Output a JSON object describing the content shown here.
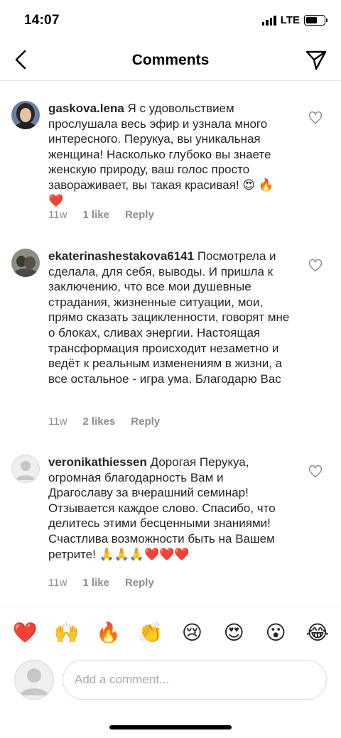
{
  "status_bar": {
    "time": "14:07",
    "network": "LTE",
    "battery_level": 0.62
  },
  "nav": {
    "title": "Comments",
    "back_icon": "chevron-left-icon",
    "send_icon": "paper-plane-icon"
  },
  "comments": [
    {
      "username": "gaskova.lena",
      "text": "Я с удовольствием прослушала весь эфир и узнала много интересного. Перукуа, вы уникальная женщина! Насколько глубоко вы знаете женскую природу, ваш голос просто завораживает, вы такая красивая! 😍 🔥 ❤️",
      "time": "11w",
      "likes": "1 like",
      "reply_label": "Reply"
    },
    {
      "username": "ekaterinashestakova6141",
      "text": "Посмотрела и сделала, для себя, выводы. И пришла к заключению, что все мои душевные страдания, жизненные ситуации, мои, прямо сказать зацикленности, говорят мне о блоках, сливах энергии. Настоящая трансформация происходит незаметно и ведёт к реальным изменениям в жизни, а все остальное - игра ума. Благодарю Вас",
      "time": "11w",
      "likes": "2 likes",
      "reply_label": "Reply"
    },
    {
      "username": "veronikathiessen",
      "text": "Дорогая Перукуа, огромная благодарность Вам и Драгославу за вчерашний семинар! Отзывается каждое слово. Спасибо, что делитесь этими бесценными знаниями! Счастлива возможности быть на Вашем ретрите! 🙏🙏🙏❤️❤️❤️",
      "time": "11w",
      "likes": "1 like",
      "reply_label": "Reply"
    }
  ],
  "reactions": [
    "❤️",
    "🙌",
    "🔥",
    "👏",
    "😢",
    "😍",
    "😮",
    "😂"
  ],
  "input": {
    "placeholder": "Add a comment..."
  },
  "colors": {
    "secondary_text": "#8e8e8e",
    "border": "#dbdbdb",
    "primary_text": "#262626"
  }
}
